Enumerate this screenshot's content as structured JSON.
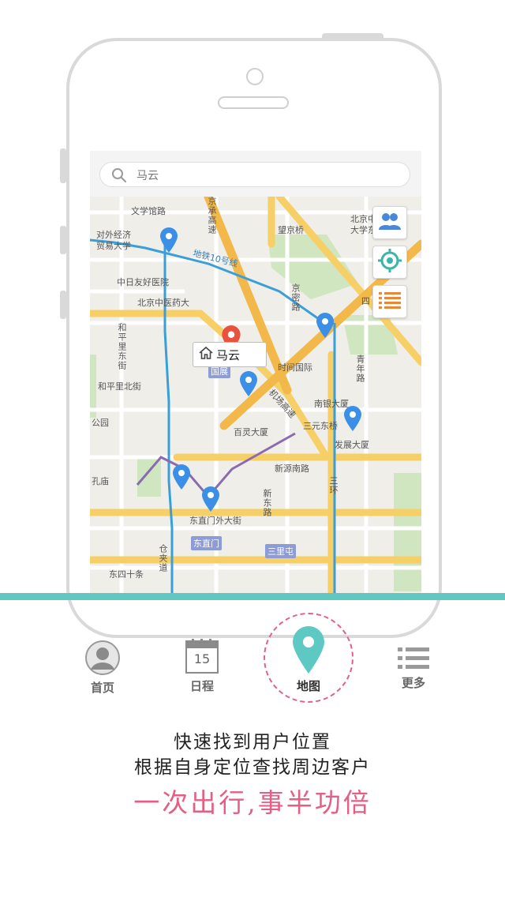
{
  "search": {
    "value": "马云"
  },
  "map": {
    "callout_name": "马云",
    "labels": {
      "wenxue": "文学馆路",
      "duiwai": "对外经济",
      "duiwai2": "贸易大学",
      "ditie": "地铁10号线",
      "zhongri": "中日友好医院",
      "beijing_zyy": "北京中医药大",
      "hepingli": "和平里东街",
      "hepingli_bei": "和平里北街",
      "gongyuan": "公园",
      "kongmiao": "孔庙",
      "wangjingqiao": "望京桥",
      "beijing_zyy2": "北京中医药",
      "daxue_dong": "大学东校区",
      "jingcheng": "京承高速",
      "jingmi": "京密路",
      "shijian": "时间国际",
      "nanyin": "南银大厦",
      "sanyuan": "三元东桥",
      "fazhan": "发展大厦",
      "bailing": "百灵大厦",
      "xinyuannan": "新源南路",
      "xindong": "新东路",
      "dongzhimen_wai": "东直门外大街",
      "dongsishi": "东四十条",
      "jichang": "机场高速",
      "sanhuan": "三环",
      "si": "四",
      "qingnian": "青年路",
      "cangjia": "仓夹道"
    },
    "tags": {
      "guozhan": "国展",
      "dongzhimen": "东直门",
      "sanlitun": "三里屯"
    }
  },
  "tabs": [
    {
      "id": "home",
      "label": "首页",
      "icon": "user-icon"
    },
    {
      "id": "schedule",
      "label": "日程",
      "icon": "calendar-icon",
      "date": "15"
    },
    {
      "id": "map",
      "label": "地图",
      "icon": "location-pin-icon",
      "active": true
    },
    {
      "id": "more",
      "label": "更多",
      "icon": "list-icon"
    }
  ],
  "promo": {
    "line1": "快速找到用户位置",
    "line2": "根据自身定位查找周边客户",
    "slogan": "一次出行,事半功倍"
  },
  "colors": {
    "accent": "#5ec9c2",
    "slogan": "#e55f84",
    "pin_blue": "#3b8fe6",
    "pin_red": "#e8523f",
    "road_yellow": "#f7cf67"
  }
}
